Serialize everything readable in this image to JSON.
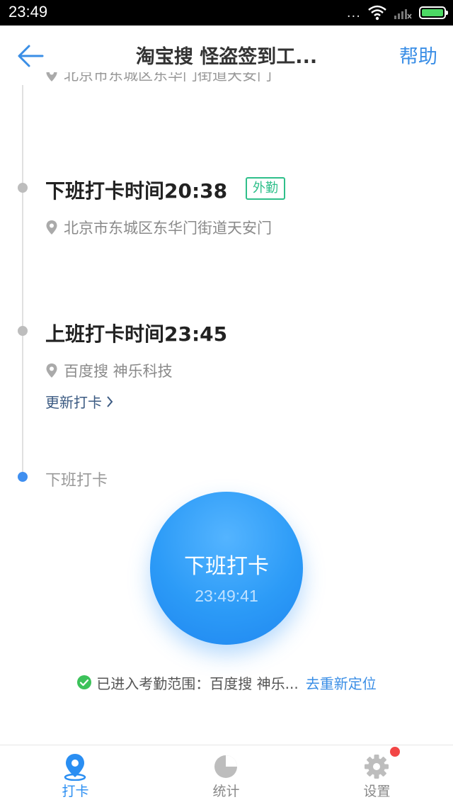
{
  "status_bar": {
    "time": "23:49",
    "indicator": "..."
  },
  "header": {
    "title": "淘宝搜 怪盗签到工...",
    "help_label": "帮助"
  },
  "timeline": {
    "partial_address": "北京市东城区东华门街道天安门",
    "records": [
      {
        "title": "下班打卡时间20:38",
        "badge": "外勤",
        "address": "北京市东城区东华门街道天安门"
      },
      {
        "title": "上班打卡时间23:45",
        "address": "百度搜 神乐科技",
        "update_label": "更新打卡"
      }
    ],
    "pending_label": "下班打卡"
  },
  "checkin_button": {
    "label": "下班打卡",
    "clock": "23:49:41"
  },
  "range_status": {
    "text": "已进入考勤范围：百度搜 神乐...",
    "relocate_label": "去重新定位"
  },
  "tabs": [
    {
      "label": "打卡",
      "icon": "location-pin-icon",
      "active": true
    },
    {
      "label": "统计",
      "icon": "pie-chart-icon",
      "active": false
    },
    {
      "label": "设置",
      "icon": "gear-icon",
      "active": false,
      "has_badge": true
    }
  ],
  "colors": {
    "accent": "#3a8ee6",
    "badge_green": "#2fbf8a",
    "button_blue": "#2c9bf7",
    "notification_red": "#f24646",
    "success_green": "#3cc25a"
  }
}
